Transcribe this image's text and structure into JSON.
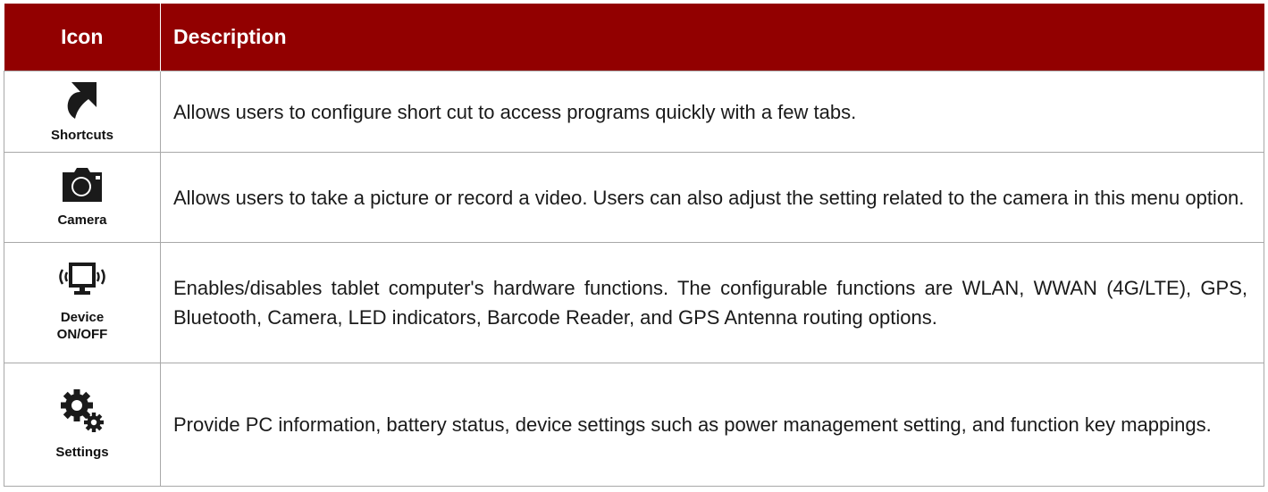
{
  "header": {
    "icon_col": "Icon",
    "desc_col": "Description"
  },
  "rows": [
    {
      "icon": "shortcut-arrow-icon",
      "label": "Shortcuts",
      "description": "Allows users to configure short cut to access programs quickly with a few tabs."
    },
    {
      "icon": "camera-icon",
      "label": "Camera",
      "description": "Allows users to take a picture or record a video. Users can also adjust the setting related to the camera in this menu option."
    },
    {
      "icon": "device-monitor-wireless-icon",
      "label": "Device ON/OFF",
      "description": "Enables/disables tablet computer's hardware functions. The configurable functions are WLAN, WWAN (4G/LTE), GPS, Bluetooth, Camera, LED indicators, Barcode Reader, and GPS Antenna routing options."
    },
    {
      "icon": "settings-gears-icon",
      "label": "Settings",
      "description": "Provide PC information, battery status, device settings such as power management setting, and function key mappings."
    }
  ],
  "colors": {
    "header_bg": "#920000",
    "header_text": "#ffffff",
    "grid": "#a8a8a8",
    "icon": "#1a1a1a"
  }
}
